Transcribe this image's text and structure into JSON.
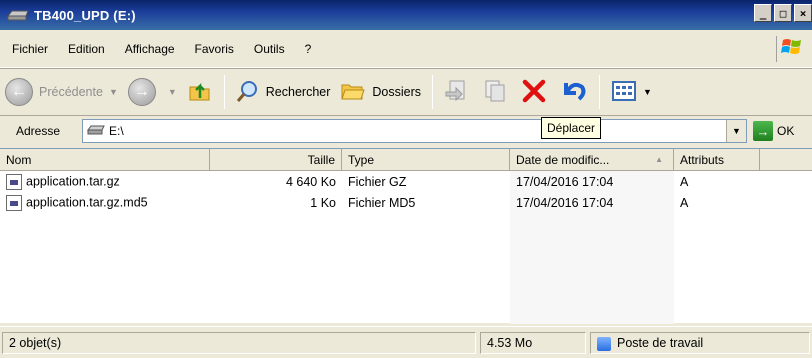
{
  "window": {
    "title": "TB400_UPD (E:)"
  },
  "menu": {
    "items": [
      {
        "label": "Fichier"
      },
      {
        "label": "Edition"
      },
      {
        "label": "Affichage"
      },
      {
        "label": "Favoris"
      },
      {
        "label": "Outils"
      },
      {
        "label": "?"
      }
    ]
  },
  "toolbar": {
    "back_label": "Précédente",
    "search_label": "Rechercher",
    "folders_label": "Dossiers",
    "tooltip": "Déplacer"
  },
  "address": {
    "label": "Adresse",
    "value": "E:\\",
    "go_label": "OK"
  },
  "columns": [
    "Nom",
    "Taille",
    "Type",
    "Date de modific...",
    "Attributs"
  ],
  "files": [
    {
      "name": "application.tar.gz",
      "size": "4 640 Ko",
      "type": "Fichier GZ",
      "date": "17/04/2016 17:04",
      "attr": "A"
    },
    {
      "name": "application.tar.gz.md5",
      "size": "1 Ko",
      "type": "Fichier MD5",
      "date": "17/04/2016 17:04",
      "attr": "A"
    }
  ],
  "status": {
    "objects": "2 objet(s)",
    "size": "4.53 Mo",
    "location": "Poste de travail"
  },
  "colors": {
    "title_bar": "#0a246a",
    "delete_red": "#e01010",
    "tooltip_bg": "#ffffe1"
  }
}
